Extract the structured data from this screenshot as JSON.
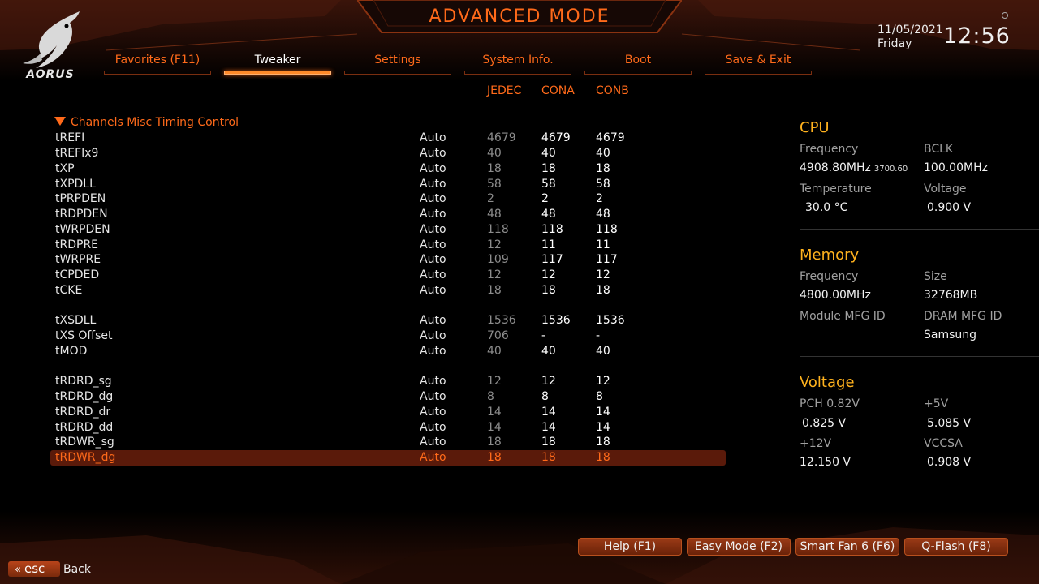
{
  "header": {
    "title": "ADVANCED MODE",
    "logo": "AORUS",
    "date": "11/05/2021",
    "day": "Friday",
    "time": "12:56"
  },
  "tabs": [
    {
      "label": "Favorites (F11)",
      "active": false
    },
    {
      "label": "Tweaker",
      "active": true
    },
    {
      "label": "Settings",
      "active": false
    },
    {
      "label": "System Info.",
      "active": false
    },
    {
      "label": "Boot",
      "active": false
    },
    {
      "label": "Save & Exit",
      "active": false
    }
  ],
  "columns": [
    "JEDEC",
    "CONA",
    "CONB"
  ],
  "section": {
    "label": "Channels Misc Timing Control",
    "icon": "triangle-down-icon"
  },
  "rows": [
    {
      "name": "tREFI",
      "value": "Auto",
      "jedec": "4679",
      "cona": "4679",
      "conb": "4679"
    },
    {
      "name": "tREFIx9",
      "value": "Auto",
      "jedec": "40",
      "cona": "40",
      "conb": "40"
    },
    {
      "name": "tXP",
      "value": "Auto",
      "jedec": "18",
      "cona": "18",
      "conb": "18"
    },
    {
      "name": "tXPDLL",
      "value": "Auto",
      "jedec": "58",
      "cona": "58",
      "conb": "58"
    },
    {
      "name": "tPRPDEN",
      "value": "Auto",
      "jedec": "2",
      "cona": "2",
      "conb": "2"
    },
    {
      "name": "tRDPDEN",
      "value": "Auto",
      "jedec": "48",
      "cona": "48",
      "conb": "48"
    },
    {
      "name": "tWRPDEN",
      "value": "Auto",
      "jedec": "118",
      "cona": "118",
      "conb": "118"
    },
    {
      "name": "tRDPRE",
      "value": "Auto",
      "jedec": "12",
      "cona": "11",
      "conb": "11"
    },
    {
      "name": "tWRPRE",
      "value": "Auto",
      "jedec": "109",
      "cona": "117",
      "conb": "117"
    },
    {
      "name": "tCPDED",
      "value": "Auto",
      "jedec": "12",
      "cona": "12",
      "conb": "12"
    },
    {
      "name": "tCKE",
      "value": "Auto",
      "jedec": "18",
      "cona": "18",
      "conb": "18"
    },
    {
      "name": "tXSDLL",
      "value": "Auto",
      "jedec": "1536",
      "cona": "1536",
      "conb": "1536"
    },
    {
      "name": "tXS Offset",
      "value": "Auto",
      "jedec": "706",
      "cona": "-",
      "conb": "-"
    },
    {
      "name": "tMOD",
      "value": "Auto",
      "jedec": "40",
      "cona": "40",
      "conb": "40"
    },
    {
      "name": "tRDRD_sg",
      "value": "Auto",
      "jedec": "12",
      "cona": "12",
      "conb": "12"
    },
    {
      "name": "tRDRD_dg",
      "value": "Auto",
      "jedec": "8",
      "cona": "8",
      "conb": "8"
    },
    {
      "name": "tRDRD_dr",
      "value": "Auto",
      "jedec": "14",
      "cona": "14",
      "conb": "14"
    },
    {
      "name": "tRDRD_dd",
      "value": "Auto",
      "jedec": "14",
      "cona": "14",
      "conb": "14"
    },
    {
      "name": "tRDWR_sg",
      "value": "Auto",
      "jedec": "18",
      "cona": "18",
      "conb": "18"
    },
    {
      "name": "tRDWR_dg",
      "value": "Auto",
      "jedec": "18",
      "cona": "18",
      "conb": "18",
      "selected": true
    }
  ],
  "panel": {
    "cpu": {
      "title": "CPU",
      "frequency_label": "Frequency",
      "frequency_value": "4908.80MHz",
      "frequency_sub": "3700.60",
      "bclk_label": "BCLK",
      "bclk_value": "100.00MHz",
      "temperature_label": "Temperature",
      "temperature_value": "30.0 °C",
      "voltage_label": "Voltage",
      "voltage_value": "0.900 V"
    },
    "memory": {
      "title": "Memory",
      "frequency_label": "Frequency",
      "frequency_value": "4800.00MHz",
      "size_label": "Size",
      "size_value": "32768MB",
      "module_mfg_label": "Module MFG ID",
      "module_mfg_value": "",
      "dram_mfg_label": "DRAM MFG ID",
      "dram_mfg_value": "Samsung"
    },
    "voltage": {
      "title": "Voltage",
      "pch_label": "PCH 0.82V",
      "pch_value": "0.825 V",
      "p5v_label": "+5V",
      "p5v_value": "5.085 V",
      "p12v_label": "+12V",
      "p12v_value": "12.150 V",
      "vccsa_label": "VCCSA",
      "vccsa_value": "0.908 V"
    }
  },
  "footer": {
    "buttons": [
      "Help (F1)",
      "Easy Mode (F2)",
      "Smart Fan 6 (F6)",
      "Q-Flash (F8)"
    ],
    "esc_label": "esc",
    "back_label": "Back"
  },
  "colors": {
    "accent": "#ff6a1a",
    "panel_title": "#ffb21e",
    "selected_row": "#5a1a0a"
  }
}
